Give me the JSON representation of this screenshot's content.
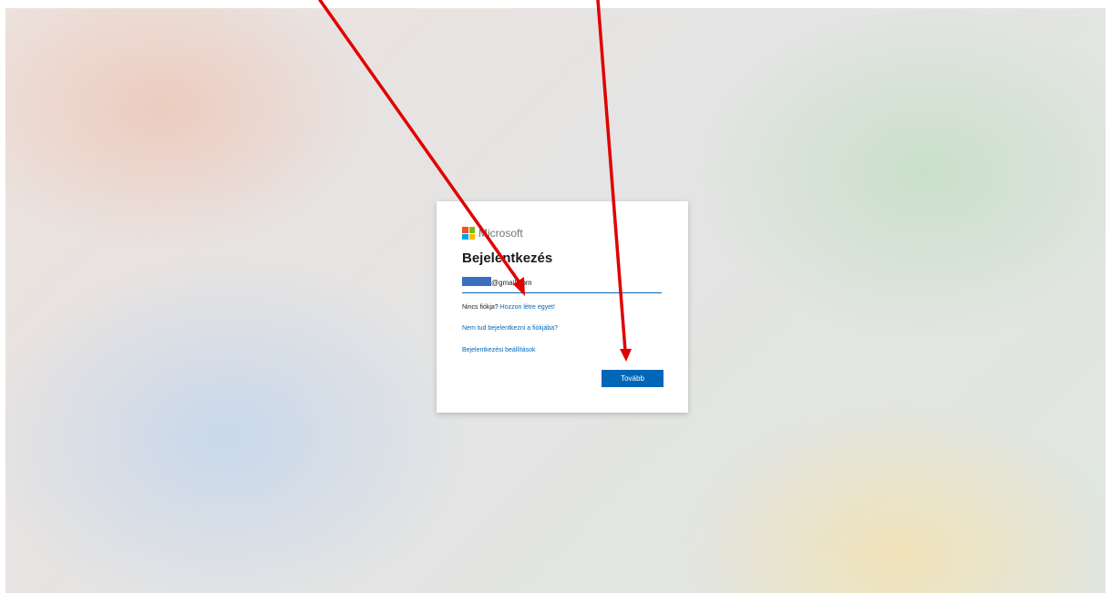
{
  "brand": {
    "name": "Microsoft",
    "logo_colors": [
      "#f25022",
      "#7fba00",
      "#00a4ef",
      "#ffb900"
    ]
  },
  "signin": {
    "title": "Bejelentkezés",
    "email_value": "@gmail.com",
    "no_account_text": "Nincs fiókja?",
    "create_link": "Hozzon létre egyet!",
    "cant_access_link": "Nem tud bejelentkezni a fiókjába?",
    "options_link": "Bejelentkezési beállítások",
    "next_label": "Tovább"
  },
  "colors": {
    "accent": "#0067b8",
    "annotation_arrow": "#e00000"
  }
}
